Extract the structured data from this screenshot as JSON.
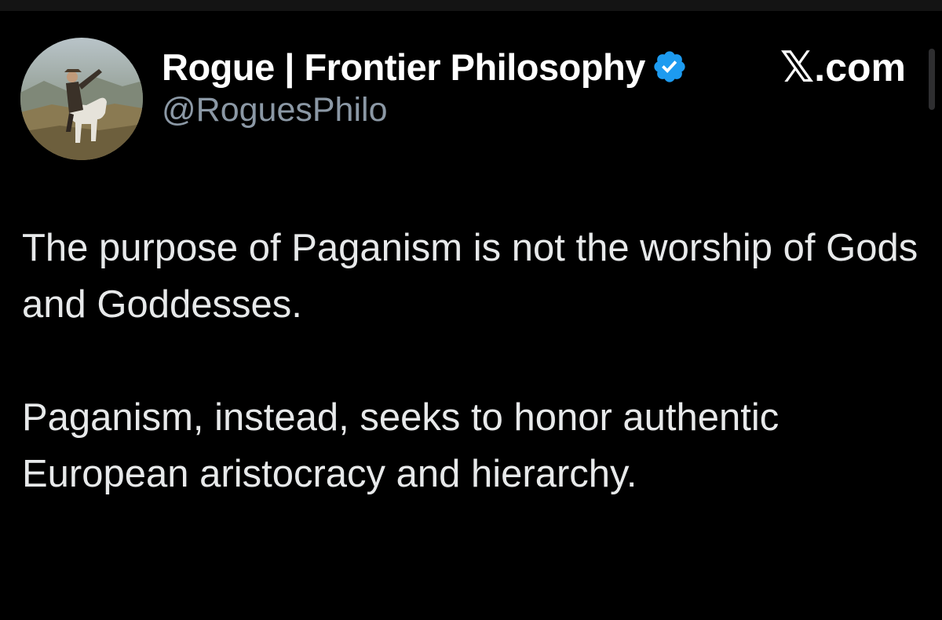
{
  "author": {
    "display_name": "Rogue | Frontier Philosophy",
    "handle": "@RoguesPhilo",
    "verified": true,
    "avatar_description_icon": "profile-photo",
    "badge_color": "#1d9bf0"
  },
  "source": {
    "x_glyph": "𝕏",
    "site": ".com"
  },
  "post": {
    "paragraphs": [
      "The purpose of Paganism is not the worship of Gods and Goddesses.",
      "Paganism, instead, seeks to honor authentic European aristocracy and hierarchy."
    ]
  },
  "colors": {
    "background": "#000000",
    "text_primary": "#e7e9ea",
    "text_secondary": "#8b98a5",
    "verified_blue": "#1d9bf0"
  }
}
